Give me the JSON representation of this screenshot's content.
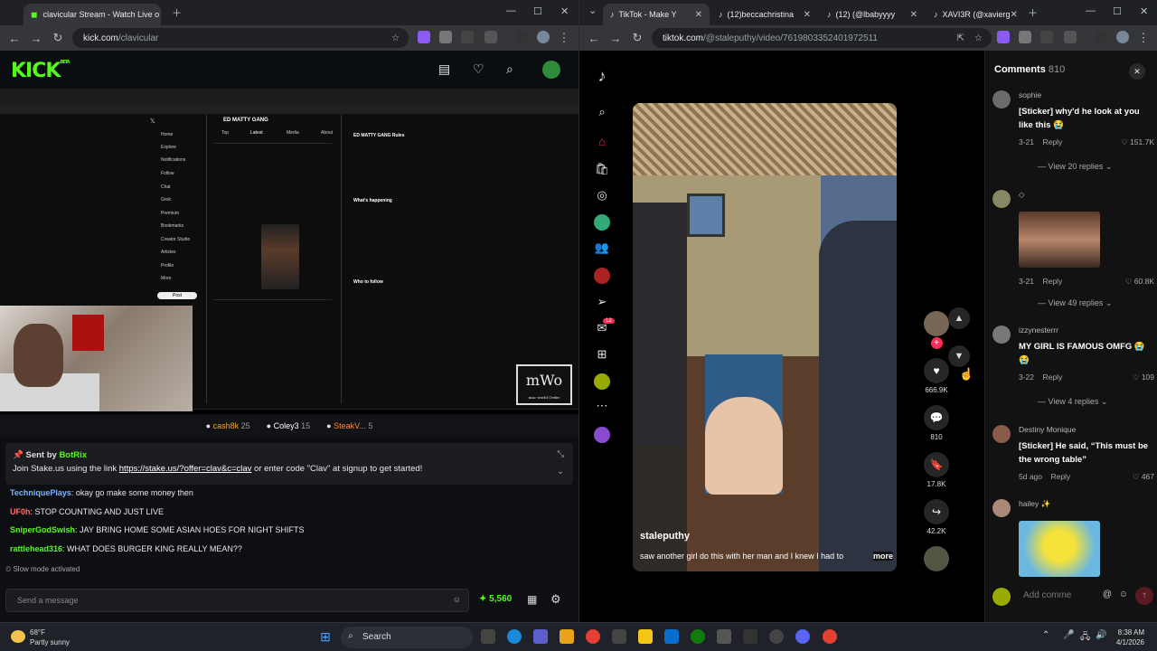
{
  "left_browser": {
    "tab_title": "clavicular Stream - Watch Live o",
    "url_domain": "kick.com",
    "url_path": "/clavicular"
  },
  "kick": {
    "logo": "KICK",
    "logo_sup": "BETA",
    "stream_overlay": {
      "tweet_header": "ED MATTY GANG",
      "tweet_tabs": [
        "Top",
        "Latest",
        "Media",
        "About"
      ],
      "rules_title": "ED MATTY GANG Rules",
      "happening": "What's happening",
      "who_to_follow": "Who to follow",
      "sidebar": [
        "Home",
        "Explore",
        "Notifications",
        "Follow",
        "Chat",
        "Grok",
        "Premium",
        "Bookmarks",
        "Creator Studio",
        "Articles",
        "Profile",
        "More"
      ],
      "post_button": "Post",
      "watermark_big": "mWo",
      "watermark_small": "mac world Order"
    },
    "leaderboard": [
      {
        "name": "cash8k",
        "count": "25"
      },
      {
        "name": "Coley3",
        "count": "15"
      },
      {
        "name": "SteakV...",
        "count": "5"
      }
    ],
    "pinned": {
      "sent_by": "Sent by",
      "bot": "BotRix",
      "text_before": "Join Stake.us using the link ",
      "link": "https://stake.us/?offer=clav&c=clav",
      "text_after": " or enter code \"Clav\" at signup to get started!"
    },
    "chat": [
      {
        "user": "TechniquePlays",
        "color": "#7fb3ff",
        "msg": ": okay go make some money then"
      },
      {
        "user": "UF0h",
        "color": "#ff6b6b",
        "msg": ": STOP COUNTING AND JUST LIVE"
      },
      {
        "user": "SniperGodSwish",
        "color": "#53fc18",
        "msg": ": JAY BRING HOME SOME ASIAN HOES FOR NIGHT SHIFTS"
      },
      {
        "user": "rattlehead316",
        "color": "#53fc18",
        "msg": ": WHAT DOES BURGER KING REALLY MEAN??"
      }
    ],
    "slow_mode": "Slow mode activated",
    "message_placeholder": "Send a message",
    "points": "5,560"
  },
  "right_browser": {
    "tabs": [
      "TikTok - Make Y",
      "(12)beccachristina",
      "(12) (@lbabyyyy",
      "XAVI3R (@xavierg"
    ],
    "url_domain": "tiktok.com",
    "url_path": "/@staleputhy/video/7619803352401972511"
  },
  "tiktok": {
    "notif_badge": "12",
    "username": "staleputhy",
    "caption": "saw another girl do this with her man and I knew I had to",
    "more": "more",
    "likes": "666.9K",
    "comments_count": "810",
    "saves": "17.8K",
    "shares": "42.2K",
    "comments_title": "Comments",
    "comments": [
      {
        "name": "sophie",
        "text": "[Sticker] why'd he look at you like this 😭",
        "date": "3-21",
        "reply": "Reply",
        "likes": "151.7K",
        "replies": "View 20 replies"
      },
      {
        "name": "◇",
        "text": "",
        "date": "3-21",
        "reply": "Reply",
        "likes": "60.8K",
        "replies": "View 49 replies"
      },
      {
        "name": "izzynesterrr",
        "text": "MY GIRL IS FAMOUS OMFG 😭😭",
        "date": "3-22",
        "reply": "Reply",
        "likes": "109",
        "replies": "View 4 replies"
      },
      {
        "name": "Destiny Monique",
        "text": "[Sticker] He said, “This must be the wrong table”",
        "date": "5d ago",
        "reply": "Reply",
        "likes": "467",
        "replies": ""
      },
      {
        "name": "hailey ✨",
        "text": "",
        "date": "",
        "reply": "",
        "likes": "",
        "replies": ""
      }
    ],
    "add_comment": "Add comme"
  },
  "taskbar": {
    "temp": "68°F",
    "condition": "Partly sunny",
    "search": "Search",
    "time": "8:38 AM",
    "date": "4/1/2026"
  }
}
